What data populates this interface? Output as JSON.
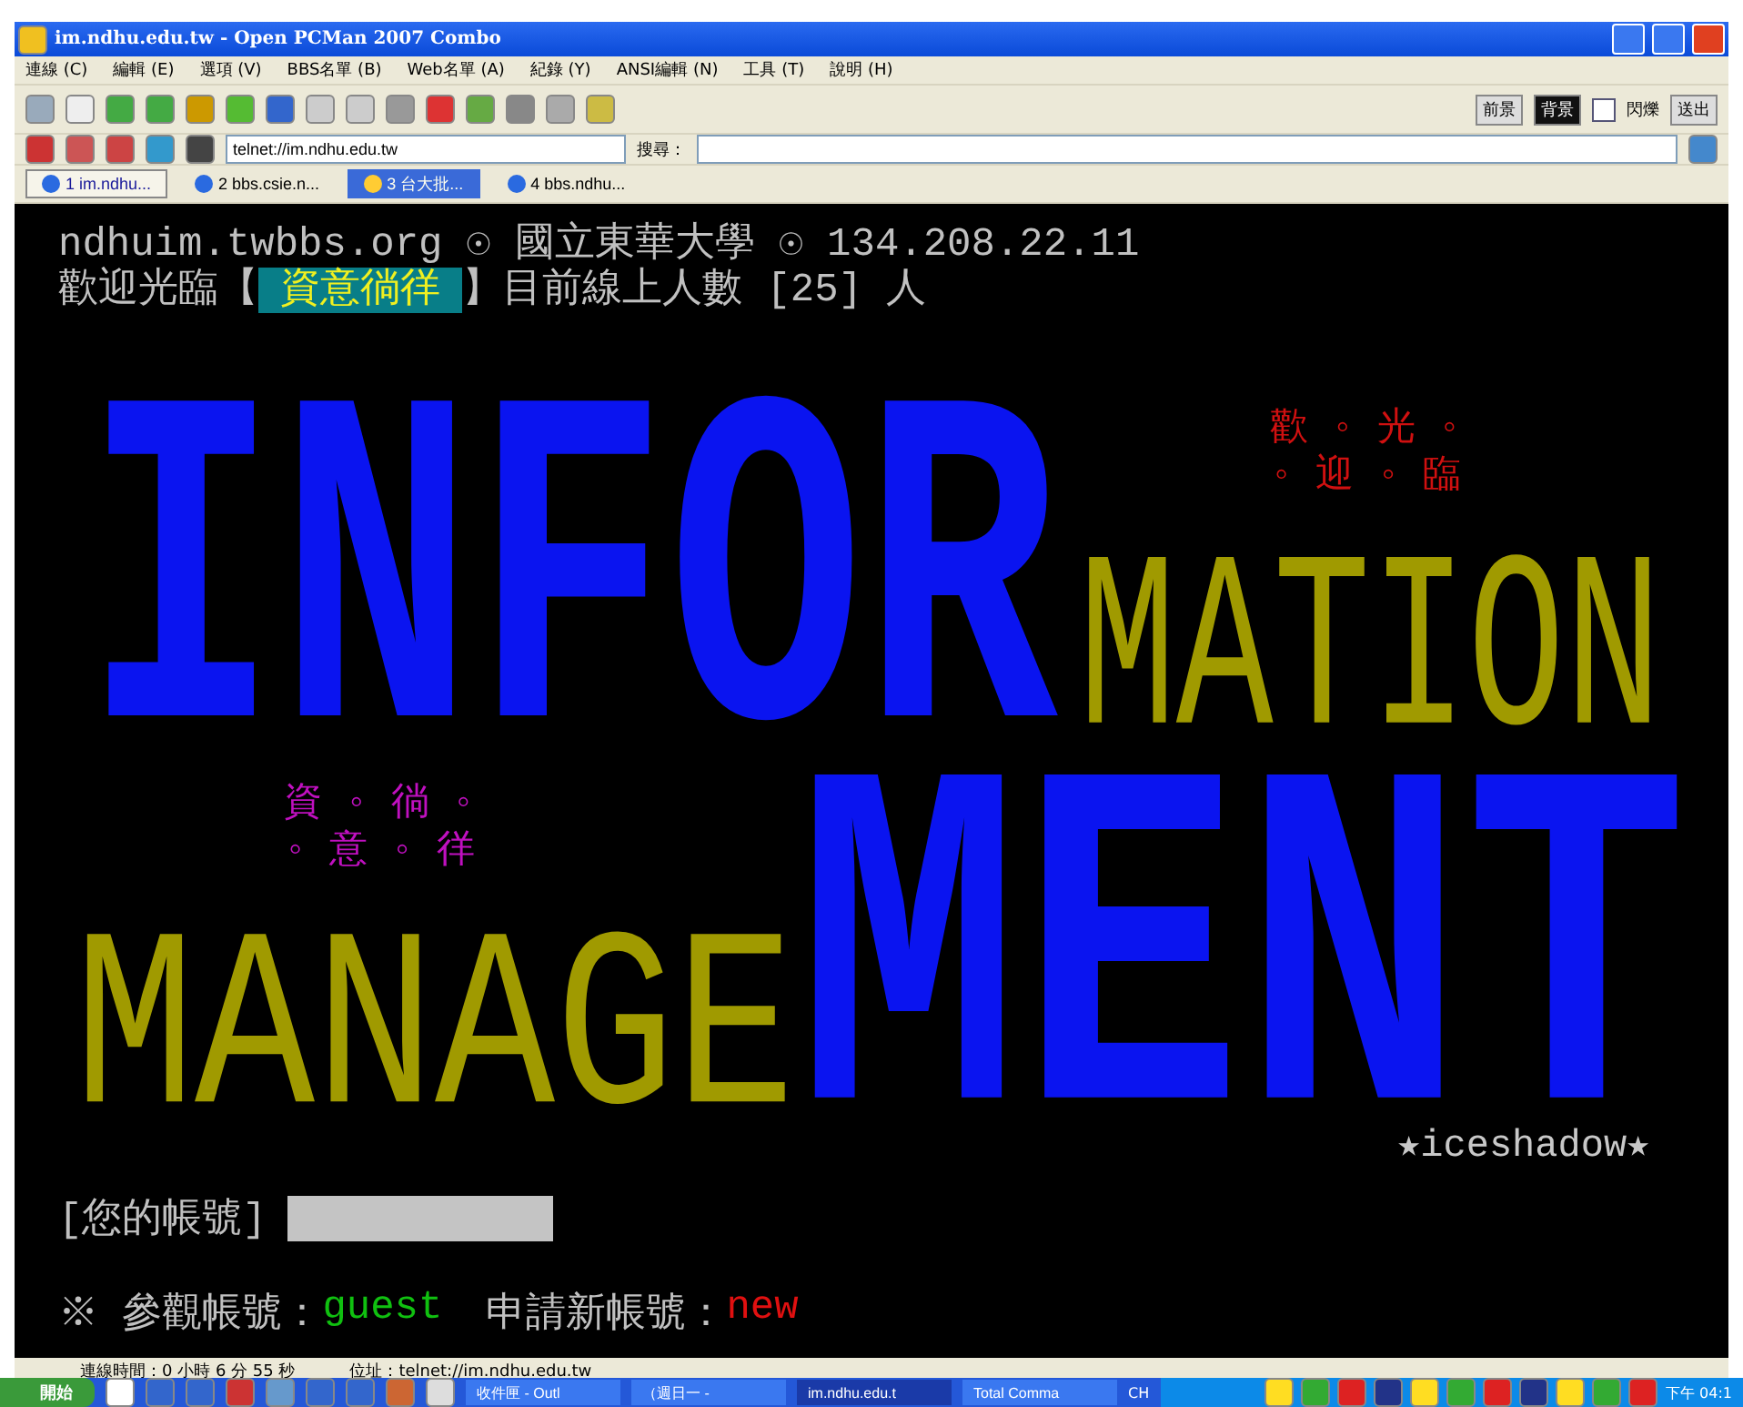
{
  "window": {
    "title": "im.ndhu.edu.tw - Open PCMan 2007 Combo"
  },
  "menu": [
    "連線 (C)",
    "編輯 (E)",
    "選項 (V)",
    "BBS名單 (B)",
    "Web名單 (A)",
    "紀錄 (Y)",
    "ANSI編輯 (N)",
    "工具 (T)",
    "說明 (H)"
  ],
  "color_bar": {
    "buttons": [
      {
        "label": "前景",
        "selected": false
      },
      {
        "label": "背景",
        "selected": true
      }
    ],
    "blink": {
      "label": "閃爍",
      "checked": false
    },
    "send": "送出"
  },
  "address": {
    "value": "telnet://im.ndhu.edu.tw"
  },
  "search": {
    "label": "搜尋："
  },
  "tabs": [
    {
      "label": "1 im.ndhu...",
      "selected": true,
      "highlighted": false
    },
    {
      "label": "2 bbs.csie.n...",
      "selected": false,
      "highlighted": false
    },
    {
      "label": "3 台大批...",
      "selected": false,
      "highlighted": true
    },
    {
      "label": "4 bbs.ndhu...",
      "selected": false,
      "highlighted": false
    }
  ],
  "terminal": {
    "header": "ndhuim.twbbs.org ☉ 國立東華大學 ☉ 134.208.22.11",
    "welcome_prefix": "歡迎光臨【",
    "board_name": "資意徜徉",
    "welcome_suffix": "】目前線上人數 [25] 人",
    "art": [
      {
        "kind": "block",
        "lines": [
          "INFOR"
        ],
        "color": "#0a14f0"
      },
      {
        "kind": "small",
        "lines": [
          "歡 ◦ 光 ◦",
          "◦ 迎 ◦ 臨"
        ],
        "color": "#d01010"
      },
      {
        "kind": "outline",
        "lines": [
          "MATION"
        ],
        "color": "#a09a00"
      },
      {
        "kind": "small",
        "lines": [
          "資 ◦ 徜 ◦",
          "◦ 意 ◦ 徉"
        ],
        "color": "#c010c0"
      },
      {
        "kind": "outline",
        "lines": [
          "MANAGE"
        ],
        "color": "#a09a00"
      },
      {
        "kind": "block",
        "lines": [
          "MENT"
        ],
        "color": "#0a14f0"
      },
      {
        "kind": "small",
        "lines": [
          "★iceshadow★"
        ],
        "color": "#c8c8c8"
      }
    ],
    "login_label": "[您的帳號]",
    "guest_prefix": "※ 參觀帳號：",
    "guest": "guest",
    "new_prefix": "申請新帳號：",
    "new": "new"
  },
  "status_bar": {
    "time": "連線時間：0 小時 6 分 55 秒",
    "address": "位址：telnet://im.ndhu.edu.tw"
  },
  "taskbar": {
    "start": "開始",
    "tasks": [
      {
        "label": "收件匣 - Outl",
        "selected": false
      },
      {
        "label": "（週日一 -",
        "selected": false
      },
      {
        "label": "im.ndhu.edu.t",
        "selected": true
      },
      {
        "label": "Total Comma",
        "selected": false
      }
    ],
    "lang": "CH",
    "clock": "下午 04:1"
  }
}
